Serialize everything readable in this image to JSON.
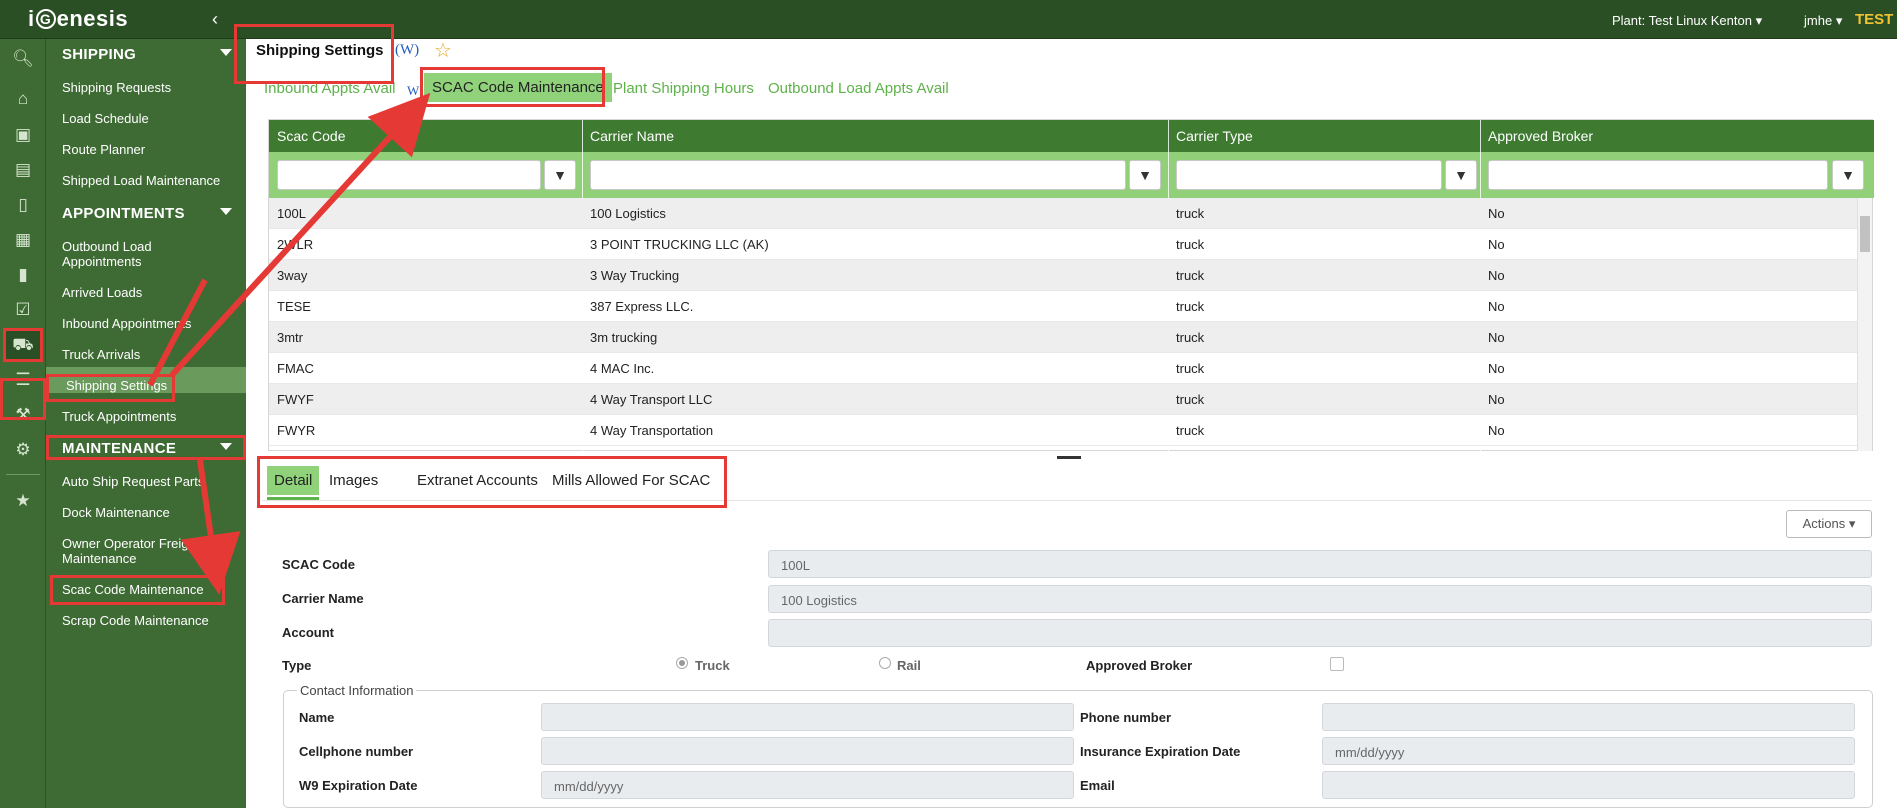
{
  "topbar": {
    "logo_pre": "i",
    "logo_g": "G",
    "logo_post": "enesis",
    "plant": "Plant: Test Linux Kenton",
    "user": "jmhe",
    "env": "TEST"
  },
  "rail_icons": [
    "search-icon",
    "home-icon",
    "forklift-icon",
    "warehouse-icon",
    "document-icon",
    "calendar-icon",
    "factory-icon",
    "clipboard-check-icon",
    "truck-icon",
    "report-icon",
    "wrench-icon",
    "gears-icon",
    "star-icon"
  ],
  "sidebar": {
    "sections": [
      {
        "title": "SHIPPING",
        "items": [
          "Shipping Requests",
          "Load Schedule",
          "Route Planner",
          "Shipped Load Maintenance"
        ]
      },
      {
        "title": "APPOINTMENTS",
        "items": [
          "Outbound Load Appointments",
          "Arrived Loads",
          "Inbound Appointments",
          "Truck Arrivals",
          "Shipping Settings",
          "Truck Appointments"
        ]
      },
      {
        "title": "MAINTENANCE",
        "items": [
          "Auto Ship Request Parts",
          "Dock Maintenance",
          "Owner Operator Freight Maintenance",
          "Scac Code Maintenance",
          "Scrap Code Maintenance"
        ]
      }
    ],
    "active_item": "Shipping Settings"
  },
  "page": {
    "title": "Shipping Settings",
    "title_w": "(W)",
    "wiki_small": "W",
    "tabs": [
      "Inbound Appts Avail",
      "SCAC Code Maintenance",
      "Plant Shipping Hours",
      "Outbound Load Appts Avail"
    ],
    "active_tab": "SCAC Code Maintenance"
  },
  "grid": {
    "columns": [
      "Scac Code",
      "Carrier Name",
      "Carrier Type",
      "Approved Broker"
    ],
    "rows": [
      [
        "100L",
        "100 Logistics",
        "truck",
        "No"
      ],
      [
        "2WLR",
        "3 POINT TRUCKING LLC (AK)",
        "truck",
        "No"
      ],
      [
        "3way",
        "3 Way Trucking",
        "truck",
        "No"
      ],
      [
        "TESE",
        "387 Express LLC.",
        "truck",
        "No"
      ],
      [
        "3mtr",
        "3m trucking",
        "truck",
        "No"
      ],
      [
        "FMAC",
        "4 MAC Inc.",
        "truck",
        "No"
      ],
      [
        "FWYF",
        "4 Way Transport LLC",
        "truck",
        "No"
      ],
      [
        "FWYR",
        "4 Way Transportation",
        "truck",
        "No"
      ]
    ]
  },
  "detail": {
    "tabs": [
      "Detail",
      "Images",
      "Extranet Accounts",
      "Mills Allowed For SCAC"
    ],
    "actions_label": "Actions",
    "scac_code_label": "SCAC Code",
    "scac_code_value": "100L",
    "carrier_name_label": "Carrier Name",
    "carrier_name_value": "100 Logistics",
    "account_label": "Account",
    "type_label": "Type",
    "type_options": [
      "Truck",
      "Rail"
    ],
    "type_selected": "Truck",
    "approved_broker_label": "Approved Broker",
    "contact_legend": "Contact Information",
    "name_label": "Name",
    "phone_label": "Phone number",
    "cellphone_label": "Cellphone number",
    "insurance_label": "Insurance Expiration Date",
    "insurance_placeholder": "mm/dd/yyyy",
    "w9_label": "W9 Expiration Date",
    "w9_placeholder": "mm/dd/yyyy",
    "email_label": "Email"
  },
  "colors": {
    "topbar": "#2b4f25",
    "sidebar": "#3e6b34",
    "grid_header": "#3e7b31",
    "grid_filter": "#91cf78",
    "accent_green": "#5eb24a",
    "annotation_red": "#e53935",
    "env_yellow": "#f1c232"
  }
}
